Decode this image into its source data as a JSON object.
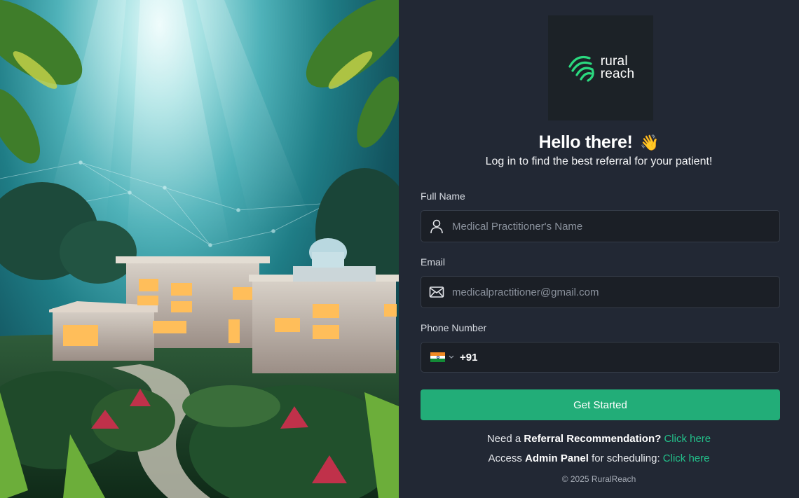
{
  "brand": {
    "logo_line1": "rural",
    "logo_line2": "reach",
    "accent_color": "#22ad78"
  },
  "greeting": {
    "title": "Hello there!",
    "emoji": "👋",
    "subtitle": "Log in to find the best referral for your patient!"
  },
  "form": {
    "full_name": {
      "label": "Full Name",
      "placeholder": "Medical Practitioner's Name",
      "icon": "user-icon"
    },
    "email": {
      "label": "Email",
      "placeholder": "medicalpractitioner@gmail.com",
      "icon": "mail-icon"
    },
    "phone": {
      "label": "Phone Number",
      "country": "India",
      "dial_code": "+91",
      "icon": "india-flag-icon"
    },
    "submit_label": "Get Started"
  },
  "links": {
    "referral": {
      "prefix": "Need a",
      "bold": "Referral Recommendation?",
      "link_text": "Click here"
    },
    "admin": {
      "prefix": "Access",
      "bold": "Admin Panel",
      "suffix": "for scheduling:",
      "link_text": "Click here"
    }
  },
  "footer": {
    "copyright": "© 2025 RuralReach"
  }
}
